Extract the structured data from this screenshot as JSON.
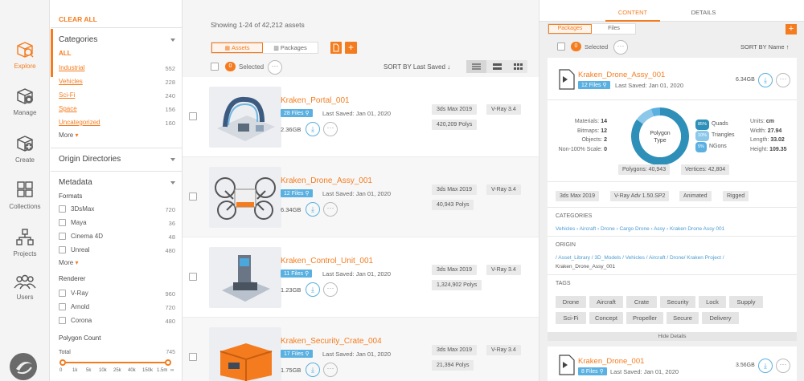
{
  "nav": {
    "items": [
      {
        "label": "Explore",
        "icon": "explore-icon"
      },
      {
        "label": "Manage",
        "icon": "manage-icon"
      },
      {
        "label": "Create",
        "icon": "create-icon"
      },
      {
        "label": "Collections",
        "icon": "collections-icon"
      },
      {
        "label": "Projects",
        "icon": "projects-icon"
      },
      {
        "label": "Users",
        "icon": "users-icon"
      }
    ]
  },
  "filters": {
    "clear_all": "CLEAR ALL",
    "categories": {
      "title": "Categories",
      "all": "ALL",
      "items": [
        {
          "label": "Industrial",
          "count": "552"
        },
        {
          "label": "Vehicles",
          "count": "228"
        },
        {
          "label": "Sci-Fi",
          "count": "240"
        },
        {
          "label": "Space",
          "count": "156"
        },
        {
          "label": "Uncategorized",
          "count": "160"
        }
      ],
      "more": "More"
    },
    "origin_title": "Origin Directories",
    "metadata": {
      "title": "Metadata",
      "formats_title": "Formats",
      "formats": [
        {
          "label": "3DsMax",
          "count": "720"
        },
        {
          "label": "Maya",
          "count": "36"
        },
        {
          "label": "Cinema 4D",
          "count": "48"
        },
        {
          "label": "Unreal",
          "count": "480"
        }
      ],
      "more": "More",
      "renderer_title": "Renderer",
      "renderers": [
        {
          "label": "V-Ray",
          "count": "960"
        },
        {
          "label": "Arnold",
          "count": "720"
        },
        {
          "label": "Corona",
          "count": "480"
        }
      ],
      "poly_title": "Polygon Count",
      "poly_total_label": "Total",
      "poly_total": "745",
      "poly_ticks": [
        "0",
        "1k",
        "5k",
        "10k",
        "25k",
        "40k",
        "150k",
        "1.5m",
        "∞"
      ]
    }
  },
  "main": {
    "showing": "Showing 1-24 of 42,212  assets",
    "tab_assets": "Assets",
    "tab_packages": "Packages",
    "selected_count": "0",
    "selected_label": "Selected",
    "sort_label": "SORT BY Last Saved",
    "assets": [
      {
        "title": "Kraken_Portal_001",
        "files": "28 Files",
        "saved": "Last Saved: Jan 01, 2020",
        "size": "2.36GB",
        "app": "3ds Max 2019",
        "renderer": "V-Ray 3.4",
        "polys": "420,209 Polys"
      },
      {
        "title": "Kraken_Drone_Assy_001",
        "files": "12 Files",
        "saved": "Last Saved: Jan 01, 2020",
        "size": "6.34GB",
        "app": "3ds Max 2019",
        "renderer": "V-Ray 3.4",
        "polys": "40,943 Polys"
      },
      {
        "title": "Kraken_Control_Unit_001",
        "files": "11 Files",
        "saved": "Last Saved: Jan 01, 2020",
        "size": "1.23GB",
        "app": "3ds Max 2019",
        "renderer": "V-Ray 3.4",
        "polys": "1,324,902 Polys"
      },
      {
        "title": "Kraken_Security_Crate_004",
        "files": "17 Files",
        "saved": "Last Saved: Jan 01, 2020",
        "size": "1.75GB",
        "app": "3ds Max 2019",
        "renderer": "V-Ray 3.4",
        "polys": "21,394 Polys"
      }
    ]
  },
  "detail": {
    "tab_content": "CONTENT",
    "tab_details": "DETAILS",
    "sub_packages": "Packages",
    "sub_files": "Files",
    "selected_count": "0",
    "selected_label": "Selected",
    "sort_label": "SORT BY Name",
    "card": {
      "title": "Kraken_Drone_Assy_001",
      "files": "12 Files",
      "saved": "Last Saved: Jan 01, 2020",
      "size": "6.34GB",
      "stats_left": [
        {
          "label": "Materials:",
          "value": "14"
        },
        {
          "label": "Bitmaps:",
          "value": "12"
        },
        {
          "label": "Objects:",
          "value": "2"
        },
        {
          "label": "Non-100% Scale:",
          "value": "0"
        }
      ],
      "donut_label_1": "Polygon",
      "donut_label_2": "Type",
      "donut_slices": [
        {
          "name": "Quads",
          "pct": "85%",
          "value": 85,
          "color": "#2e8fb8"
        },
        {
          "name": "Triangles",
          "pct": "10%",
          "value": 10,
          "color": "#8cc8ea"
        },
        {
          "name": "NGons",
          "pct": "5%",
          "value": 5,
          "color": "#5ab0e0"
        }
      ],
      "stats_right": [
        {
          "label": "Units:",
          "value": "cm"
        },
        {
          "label": "Width:",
          "value": "27.94"
        },
        {
          "label": "Length:",
          "value": "33.02"
        },
        {
          "label": "Height:",
          "value": "109.35"
        }
      ],
      "polygons": "Polygons: 40,943",
      "vertices": "Vertices: 42,804",
      "pills": [
        "3ds Max 2019",
        "V-Ray Adv 1.50.SP2",
        "Animated",
        "Rigged"
      ],
      "categories_title": "CATEGORIES",
      "categories_path": "Vehicles › Aircraft › Drone › Cargo Drone › Assy › Kraken Drone Assy 001",
      "origin_title": "ORIGIN",
      "origin_path_1": "/ Asset_Library / 3D_Models / Vehicles / Aircraft / Drone/ Kraken Project /",
      "origin_path_2": "Kraken_Drone_Assy_001",
      "tags_title": "TAGS",
      "tags": [
        "Drone",
        "Aircraft",
        "Crate",
        "Security",
        "Lock",
        "Supply",
        "Sci-Fi",
        "Concept",
        "Propeller",
        "Secure",
        "Delivery"
      ],
      "hide_details": "Hide Details"
    },
    "card2": {
      "title": "Kraken_Drone_001",
      "files": "8 Files",
      "saved": "Last Saved: Jan 01, 2020",
      "size": "3.56GB"
    }
  }
}
